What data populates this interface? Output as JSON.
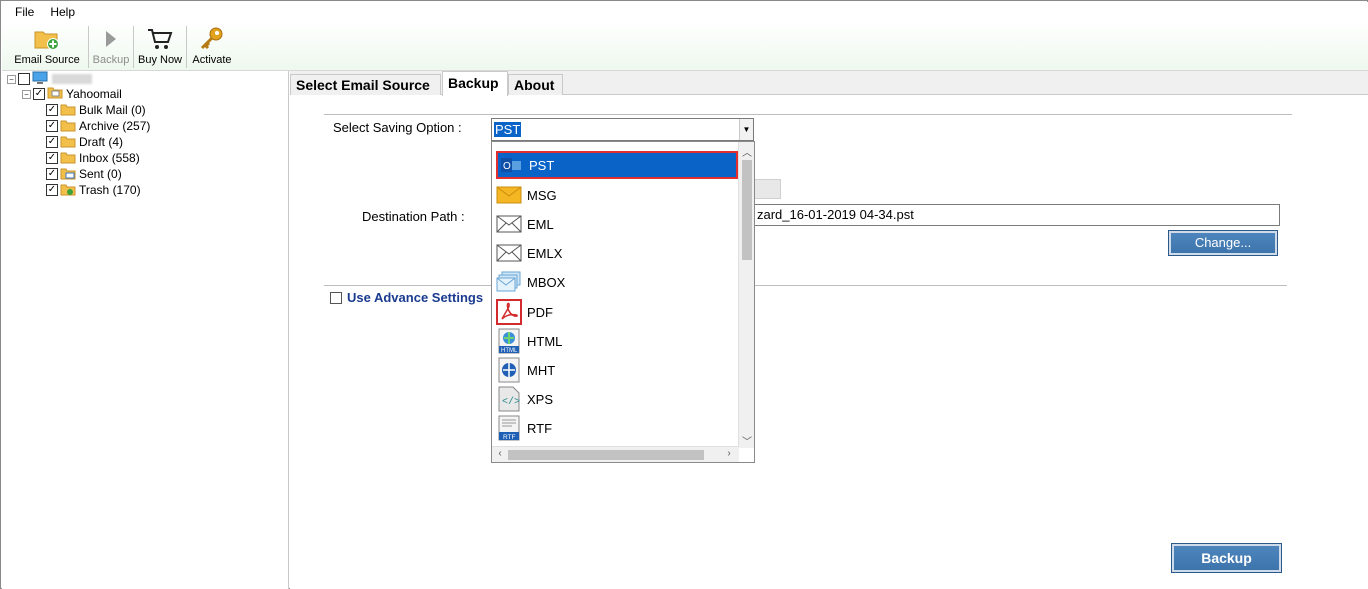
{
  "menu": {
    "file": "File",
    "help": "Help"
  },
  "toolbar": {
    "email_source": "Email Source",
    "backup": "Backup",
    "buy_now": "Buy Now",
    "activate": "Activate"
  },
  "tree": {
    "root": "",
    "account": "Yahoomail",
    "folders": [
      {
        "label": "Bulk Mail (0)",
        "icon": "folder-icon"
      },
      {
        "label": "Archive (257)",
        "icon": "folder-icon"
      },
      {
        "label": "Draft (4)",
        "icon": "folder-icon"
      },
      {
        "label": "Inbox (558)",
        "icon": "folder-icon"
      },
      {
        "label": "Sent (0)",
        "icon": "sent-folder-icon"
      },
      {
        "label": "Trash (170)",
        "icon": "trash-folder-icon"
      }
    ]
  },
  "tabs": [
    {
      "label": "Select Email Source",
      "active": false
    },
    {
      "label": "Backup",
      "active": true
    },
    {
      "label": "About",
      "active": false
    }
  ],
  "form": {
    "saving_option_label": "Select Saving Option :",
    "saving_option_value": "PST",
    "destination_label": "Destination Path :",
    "destination_value": "zard_16-01-2019 04-34.pst",
    "change_button": "Change...",
    "advance_settings": "Use Advance Settings",
    "backup_button": "Backup"
  },
  "dropdown": {
    "options": [
      {
        "label": "PST",
        "icon": "outlook-icon",
        "selected": true
      },
      {
        "label": "MSG",
        "icon": "envelope-icon",
        "selected": false
      },
      {
        "label": "EML",
        "icon": "envelope-outline-icon",
        "selected": false
      },
      {
        "label": "EMLX",
        "icon": "envelope-outline-icon",
        "selected": false
      },
      {
        "label": "MBOX",
        "icon": "mbox-icon",
        "selected": false
      },
      {
        "label": "PDF",
        "icon": "pdf-icon",
        "selected": false
      },
      {
        "label": "HTML",
        "icon": "html-icon",
        "selected": false
      },
      {
        "label": "MHT",
        "icon": "mht-icon",
        "selected": false
      },
      {
        "label": "XPS",
        "icon": "xps-icon",
        "selected": false
      },
      {
        "label": "RTF",
        "icon": "rtf-icon",
        "selected": false
      }
    ]
  },
  "colors": {
    "selection_blue": "#0a64c8",
    "highlight_red": "#e23030",
    "button_blue": "#4479b3",
    "link_blue": "#1a3b8f"
  }
}
